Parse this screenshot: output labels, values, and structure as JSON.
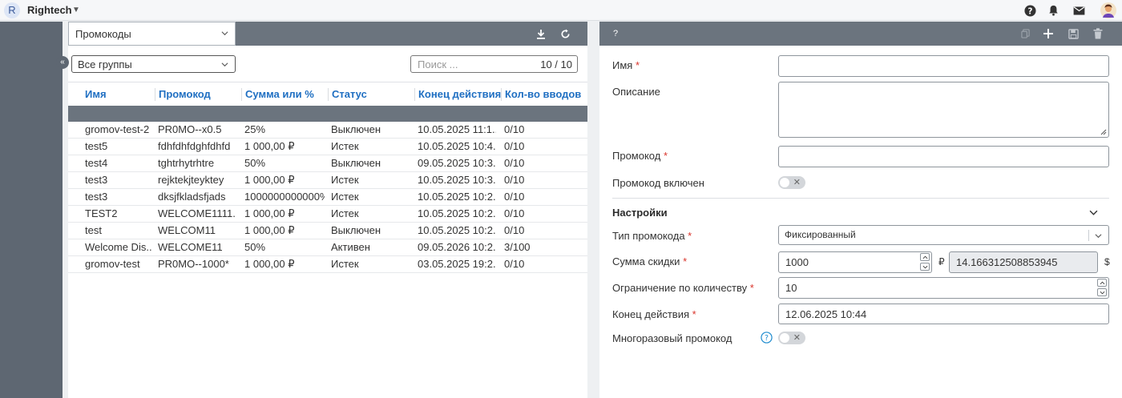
{
  "app": {
    "logo_letter": "R",
    "title": "Rightech"
  },
  "topbar_icons": [
    "help-icon",
    "bell-icon",
    "mail-icon",
    "user-avatar-icon"
  ],
  "left": {
    "entity_select": "Промокоды",
    "group_select": "Все группы",
    "search": {
      "placeholder": "Поиск ...",
      "count": "10 / 10"
    },
    "columns": [
      "Имя",
      "Промокод",
      "Сумма или %",
      "Статус",
      "Конец действия",
      "Кол-во вводов"
    ],
    "rows": [
      {
        "name": "gromov-test-2",
        "code": "PR0MO--x0.5",
        "sum": "25%",
        "status": "Выключен",
        "end": "10.05.2025 11:1...",
        "count": "0/10"
      },
      {
        "name": "test5",
        "code": "fdhfdhfdghfdhfd",
        "sum": "1 000,00 ₽",
        "status": "Истек",
        "end": "10.05.2025 10:4...",
        "count": "0/10"
      },
      {
        "name": "test4",
        "code": "tghtrhytrhtre",
        "sum": "50%",
        "status": "Выключен",
        "end": "09.05.2025 10:3...",
        "count": "0/10"
      },
      {
        "name": "test3",
        "code": "rejktekjteyktey",
        "sum": "1 000,00 ₽",
        "status": "Истек",
        "end": "10.05.2025 10:3...",
        "count": "0/10"
      },
      {
        "name": "test3",
        "code": "dksjfkladsfjads",
        "sum": "1000000000000%",
        "status": "Истек",
        "end": "10.05.2025 10:2...",
        "count": "0/10"
      },
      {
        "name": "TEST2",
        "code": "WELCOME1111...",
        "sum": "1 000,00 ₽",
        "status": "Истек",
        "end": "10.05.2025 10:2...",
        "count": "0/10"
      },
      {
        "name": "test",
        "code": "WELCOM11",
        "sum": "1 000,00 ₽",
        "status": "Выключен",
        "end": "10.05.2025 10:2...",
        "count": "0/10"
      },
      {
        "name": "Welcome Dis...",
        "code": "WELCOME11",
        "sum": "50%",
        "status": "Активен",
        "end": "09.05.2026 10:2...",
        "count": "3/100"
      },
      {
        "name": "gromov-test",
        "code": "PR0MO--1000*",
        "sum": "1 000,00 ₽",
        "status": "Истек",
        "end": "03.05.2025 19:2...",
        "count": "0/10"
      }
    ]
  },
  "right": {
    "toolbar_label": "?",
    "name_label": "Имя",
    "description_label": "Описание",
    "promocode_label": "Промокод",
    "enabled_label": "Промокод включен",
    "settings_title": "Настройки",
    "type_label": "Тип промокода",
    "type_value": "Фиксированный",
    "discount_label": "Сумма скидки",
    "discount_value": "1000",
    "currency_rub": "₽",
    "discount_usd": "14.166312508853945",
    "currency_usd": "$",
    "limit_label": "Ограничение по количеству",
    "limit_value": "10",
    "end_label": "Конец действия",
    "end_value": "12.06.2025 10:44",
    "reusable_label": "Многоразовый промокод",
    "required_mark": "*",
    "toggle_off_mark": "✕"
  }
}
